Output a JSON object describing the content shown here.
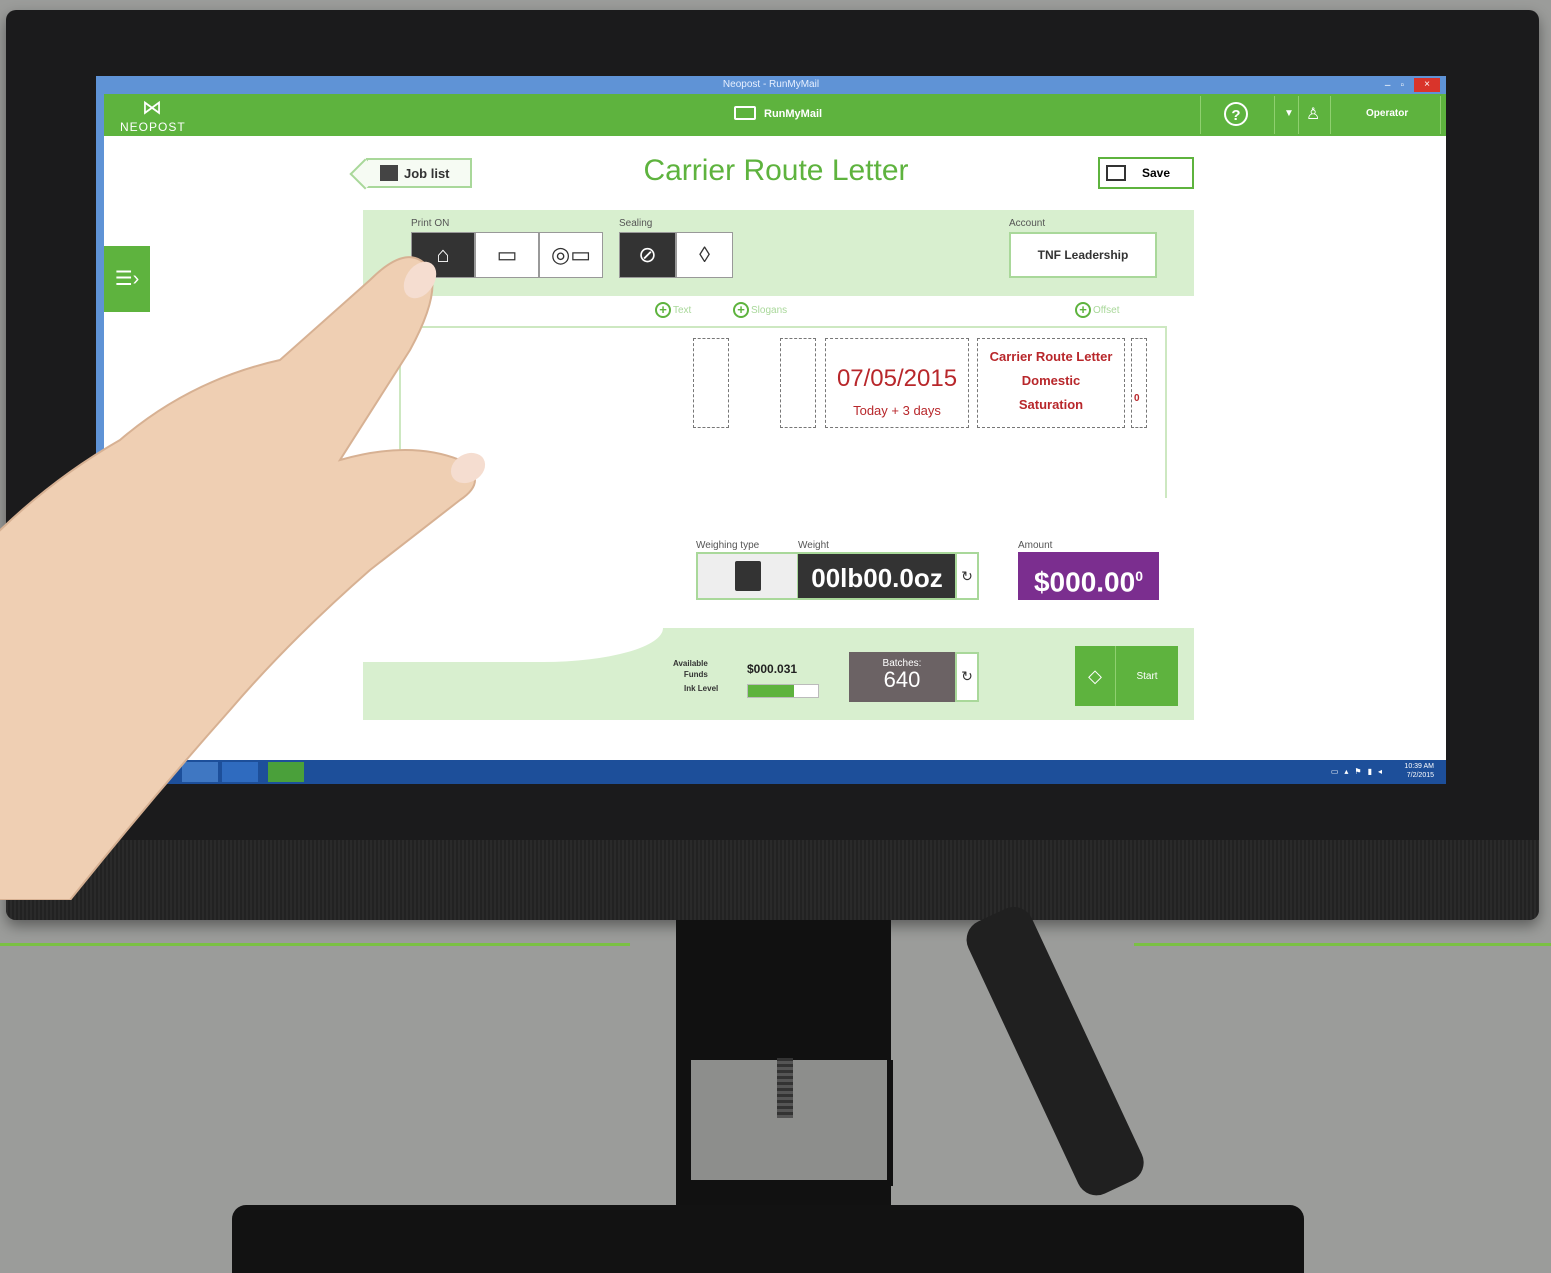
{
  "window": {
    "title": "Neopost - RunMyMail",
    "controls": [
      "–",
      "▫",
      "×"
    ]
  },
  "appbar": {
    "logo": "NEOPOST",
    "app_name": "RunMyMail",
    "help": "?",
    "operator": "Operator"
  },
  "header": {
    "job_list_label": "Job list",
    "title": "Carrier Route Letter",
    "save_label": "Save"
  },
  "print_on": {
    "label": "Print ON",
    "options": [
      "envelope",
      "label",
      "tape"
    ],
    "selected": "envelope"
  },
  "sealing": {
    "label": "Sealing",
    "options": [
      "no-seal",
      "seal"
    ],
    "selected": "no-seal"
  },
  "account": {
    "label": "Account",
    "value": "TNF Leadership"
  },
  "imprint": {
    "add_text": "Text",
    "add_slogan": "Slogans",
    "add_offset": "Offset",
    "date": "07/05/2015",
    "date_offset": "Today + 3 days",
    "rate_lines": [
      "Carrier Route Letter",
      "Domestic",
      "Saturation"
    ],
    "offset_value": "0"
  },
  "weighing": {
    "type_label": "Weighing type",
    "weight_label": "Weight",
    "weight_value": "00lb00.0oz"
  },
  "amount": {
    "label": "Amount",
    "value": "$000.00",
    "sup": "0"
  },
  "status": {
    "funds_label_1": "Available",
    "funds_label_2": "Funds",
    "funds_value": "$000.031",
    "ink_label": "Ink Level",
    "ink_level": 0.65,
    "batches_label": "Batches:",
    "batches_value": "640",
    "start_label": "Start"
  },
  "taskbar": {
    "time": "10:39 AM",
    "date": "7/2/2015"
  },
  "colors": {
    "brand_green": "#5eb33e",
    "light_green": "#d8efcf",
    "date_red": "#b8272b",
    "amount_purple": "#7b2e8f",
    "batch_gray": "#6b6264"
  }
}
